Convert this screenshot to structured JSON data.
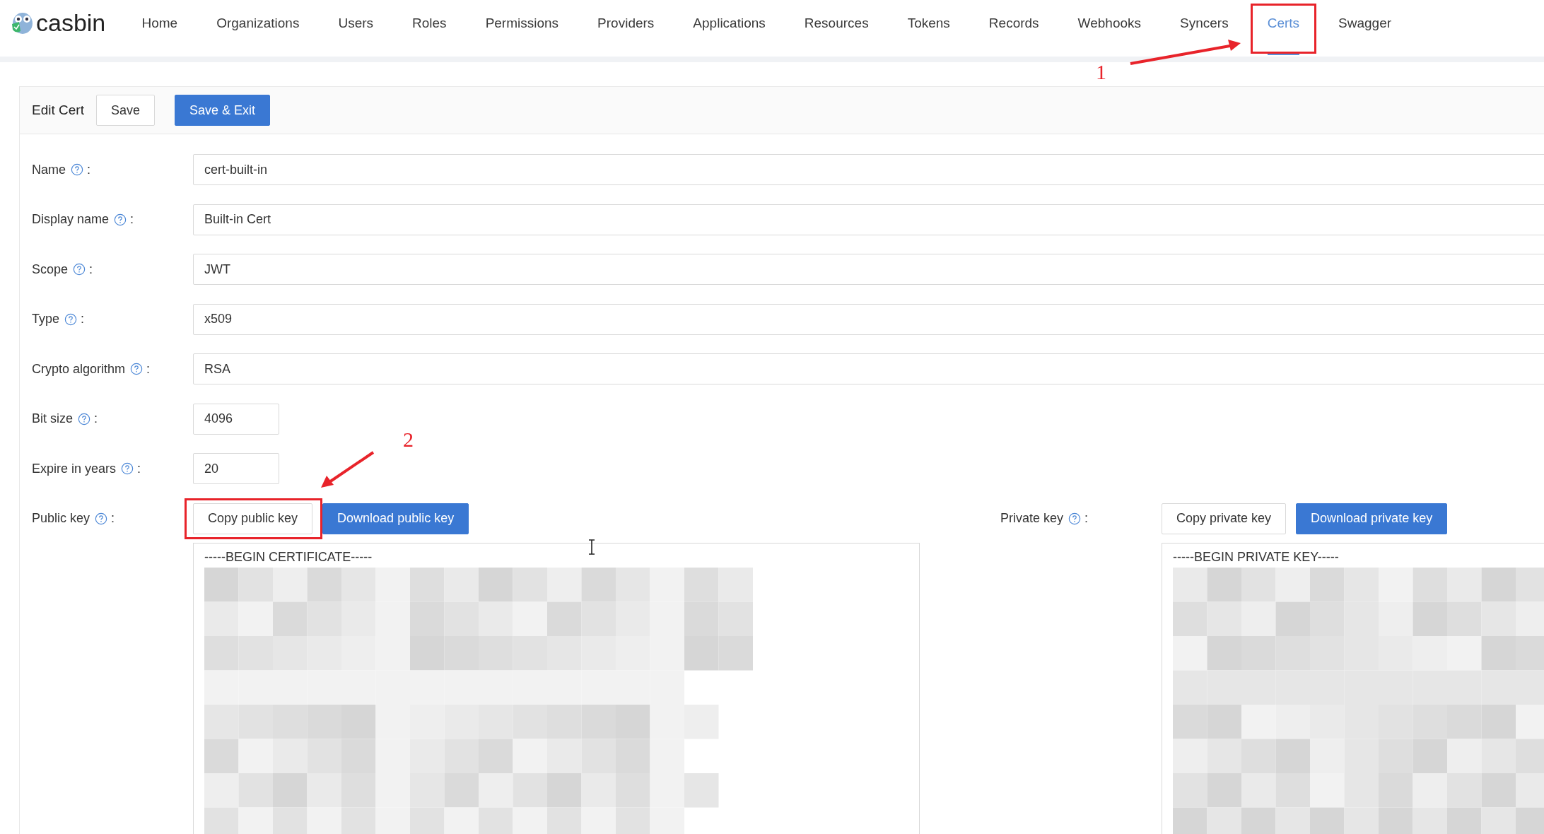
{
  "logo": {
    "text": "casbin"
  },
  "nav": [
    {
      "label": "Home",
      "selected": false,
      "annotated": false
    },
    {
      "label": "Organizations",
      "selected": false,
      "annotated": false
    },
    {
      "label": "Users",
      "selected": false,
      "annotated": false
    },
    {
      "label": "Roles",
      "selected": false,
      "annotated": false
    },
    {
      "label": "Permissions",
      "selected": false,
      "annotated": false
    },
    {
      "label": "Providers",
      "selected": false,
      "annotated": false
    },
    {
      "label": "Applications",
      "selected": false,
      "annotated": false
    },
    {
      "label": "Resources",
      "selected": false,
      "annotated": false
    },
    {
      "label": "Tokens",
      "selected": false,
      "annotated": false
    },
    {
      "label": "Records",
      "selected": false,
      "annotated": false
    },
    {
      "label": "Webhooks",
      "selected": false,
      "annotated": false
    },
    {
      "label": "Syncers",
      "selected": false,
      "annotated": false
    },
    {
      "label": "Certs",
      "selected": true,
      "annotated": true
    },
    {
      "label": "Swagger",
      "selected": false,
      "annotated": false
    }
  ],
  "card": {
    "title": "Edit Cert",
    "buttons": [
      {
        "label": "Save",
        "kind": "default"
      },
      {
        "label": "Save & Exit",
        "kind": "primary"
      }
    ]
  },
  "label_suffix": ":",
  "fields": [
    {
      "label": "Name",
      "value": "cert-built-in",
      "kind": "wide"
    },
    {
      "label": "Display name",
      "value": "Built-in Cert",
      "kind": "wide"
    },
    {
      "label": "Scope",
      "value": "JWT",
      "kind": "wide"
    },
    {
      "label": "Type",
      "value": "x509",
      "kind": "wide"
    },
    {
      "label": "Crypto algorithm",
      "value": "RSA",
      "kind": "wide"
    },
    {
      "label": "Bit size",
      "value": "4096",
      "kind": "short"
    },
    {
      "label": "Expire in years",
      "value": "20",
      "kind": "short"
    }
  ],
  "keys": [
    {
      "label": "Public key",
      "first_line": "-----BEGIN CERTIFICATE-----",
      "buttons": [
        {
          "label": "Copy public key",
          "kind": "default",
          "annotated": true
        },
        {
          "label": "Download public key",
          "kind": "primary",
          "annotated": false
        }
      ]
    },
    {
      "label": "Private key",
      "first_line": "-----BEGIN PRIVATE KEY-----",
      "buttons": [
        {
          "label": "Copy private key",
          "kind": "default",
          "annotated": false
        },
        {
          "label": "Download private key",
          "kind": "primary",
          "annotated": false
        }
      ]
    }
  ],
  "annotations": [
    {
      "label": "1"
    },
    {
      "label": "2"
    }
  ]
}
